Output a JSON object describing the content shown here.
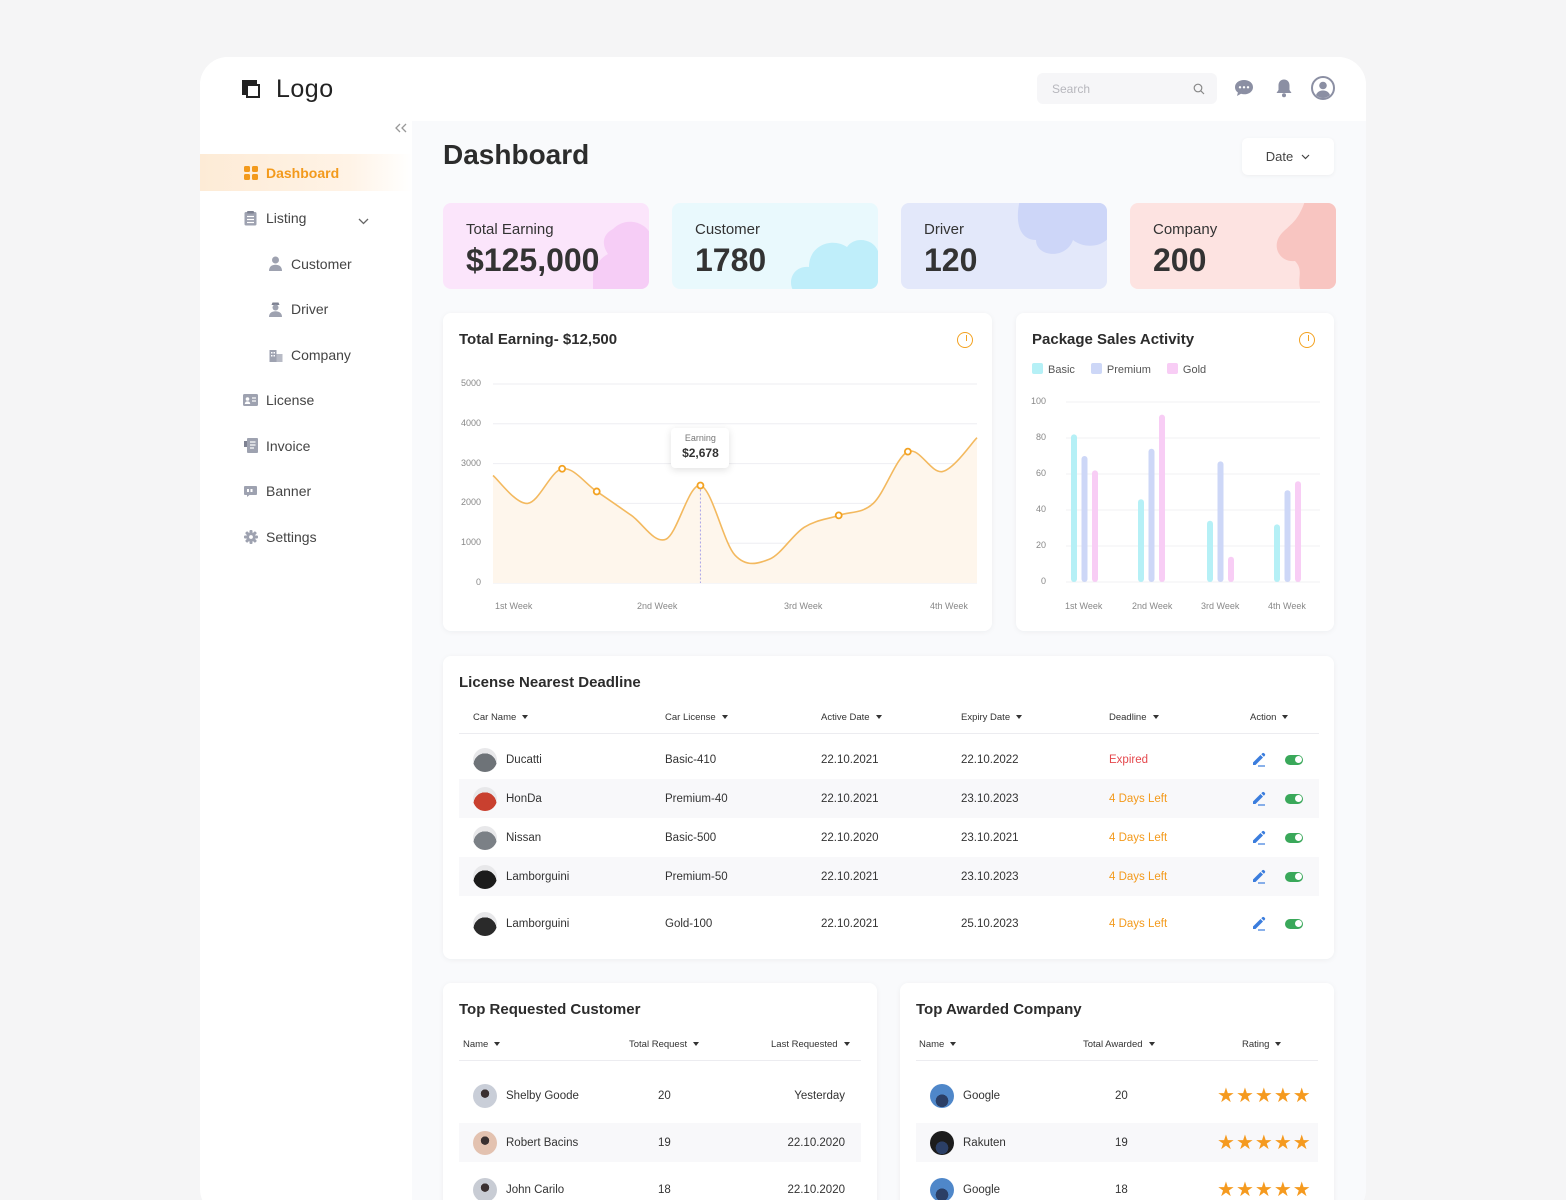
{
  "brand": {
    "logo_text": "Logo"
  },
  "search": {
    "placeholder": "Search"
  },
  "nav": {
    "items": [
      {
        "label": "Dashboard",
        "icon": "grid-icon",
        "active": true
      },
      {
        "label": "Listing",
        "icon": "list-icon"
      },
      {
        "label": "Customer",
        "icon": "user-icon",
        "sub": true
      },
      {
        "label": "Driver",
        "icon": "driver-icon",
        "sub": true
      },
      {
        "label": "Company",
        "icon": "building-icon",
        "sub": true
      },
      {
        "label": "License",
        "icon": "id-card-icon"
      },
      {
        "label": "Invoice",
        "icon": "invoice-icon"
      },
      {
        "label": "Banner",
        "icon": "banner-icon"
      },
      {
        "label": "Settings",
        "icon": "gear-icon"
      }
    ]
  },
  "page": {
    "title": "Dashboard",
    "date_label": "Date"
  },
  "stats": [
    {
      "label": "Total Earning",
      "value": "$125,000",
      "bg": "#fbe5fb",
      "blob": "#f6cdf6"
    },
    {
      "label": "Customer",
      "value": "1780",
      "bg": "#e9f9fd",
      "blob": "#bfeefa"
    },
    {
      "label": "Driver",
      "value": "120",
      "bg": "#e3e8fa",
      "blob": "#cdd6f8"
    },
    {
      "label": "Company",
      "value": "200",
      "bg": "#fde3e1",
      "blob": "#f8c5c1"
    }
  ],
  "earning_chart": {
    "title": "Total Earning- $12,500",
    "tooltip_label": "Earning",
    "tooltip_value": "$2,678",
    "chart_data": {
      "type": "area",
      "yticks": [
        "5000",
        "4000",
        "3000",
        "2000",
        "1000",
        "0"
      ],
      "ylim": [
        0,
        5000
      ],
      "xlabels": [
        "1st Week",
        "2nd Week",
        "3rd Week",
        "4th Week"
      ],
      "x": [
        0,
        0.5,
        1,
        1.5,
        2,
        2.5,
        3,
        3.5,
        4,
        4.5,
        5,
        5.5,
        6,
        6.5,
        7
      ],
      "y": [
        2700,
        2000,
        2870,
        2300,
        1700,
        1100,
        2450,
        700,
        600,
        1400,
        1700,
        2000,
        3300,
        2800,
        3650
      ],
      "markers": [
        2,
        3,
        6,
        10,
        12
      ],
      "highlight_index": 6,
      "color": "#f3b95f"
    }
  },
  "package_chart": {
    "title": "Package Sales Activity",
    "chart_data": {
      "type": "bar",
      "categories": [
        "1st Week",
        "2nd Week",
        "3rd Week",
        "4th Week"
      ],
      "yticks": [
        "100",
        "80",
        "60",
        "40",
        "20",
        "0"
      ],
      "ylim": [
        0,
        100
      ],
      "series": [
        {
          "name": "Basic",
          "color": "#b5f0f6",
          "values": [
            82,
            46,
            34,
            32
          ]
        },
        {
          "name": "Premium",
          "color": "#cdd7f7",
          "values": [
            70,
            74,
            67,
            51
          ]
        },
        {
          "name": "Gold",
          "color": "#f8cdf5",
          "values": [
            62,
            93,
            14,
            56
          ]
        }
      ]
    }
  },
  "license": {
    "title": "License Nearest Deadline",
    "headers": [
      "Car Name",
      "Car License",
      "Active Date",
      "Expiry Date",
      "Deadline",
      "Action"
    ],
    "rows": [
      {
        "car": "Ducatti",
        "license": "Basic-410",
        "active": "22.10.2021",
        "expiry": "22.10.2022",
        "deadline": "Expired",
        "status": "expired",
        "avatar": "#6e7378"
      },
      {
        "car": "HonDa",
        "license": "Premium-40",
        "active": "22.10.2021",
        "expiry": "23.10.2023",
        "deadline": "4 Days Left",
        "status": "left",
        "avatar": "#c9402f"
      },
      {
        "car": "Nissan",
        "license": "Basic-500",
        "active": "22.10.2020",
        "expiry": "23.10.2021",
        "deadline": "4 Days Left",
        "status": "left",
        "avatar": "#7b8086"
      },
      {
        "car": "Lamborguini",
        "license": "Premium-50",
        "active": "22.10.2021",
        "expiry": "23.10.2023",
        "deadline": "4 Days Left",
        "status": "left",
        "avatar": "#1b1b1b"
      },
      {
        "car": "Lamborguini",
        "license": "Gold-100",
        "active": "22.10.2021",
        "expiry": "25.10.2023",
        "deadline": "4 Days Left",
        "status": "left",
        "avatar": "#2a2a2a"
      }
    ]
  },
  "customers": {
    "title": "Top Requested Customer",
    "headers": [
      "Name",
      "Total Request",
      "Last Requested"
    ],
    "rows": [
      {
        "name": "Shelby Goode",
        "total": "20",
        "last": "Yesterday",
        "avatar": "#c9ced8"
      },
      {
        "name": "Robert Bacins",
        "total": "19",
        "last": "22.10.2020",
        "avatar": "#e3c2b0"
      },
      {
        "name": "John Carilo",
        "total": "18",
        "last": "22.10.2020",
        "avatar": "#c8ccd4"
      }
    ]
  },
  "companies": {
    "title": "Top Awarded Company",
    "headers": [
      "Name",
      "Total Awarded",
      "Rating"
    ],
    "rows": [
      {
        "name": "Google",
        "total": "20",
        "rating": 5,
        "avatar": "#4f87c9"
      },
      {
        "name": "Rakuten",
        "total": "19",
        "rating": 5,
        "avatar": "#1c1c1c"
      },
      {
        "name": "Google",
        "total": "18",
        "rating": 5,
        "avatar": "#4f87c9"
      }
    ]
  },
  "colors": {
    "accent": "#f39a1c",
    "expired": "#e5484d",
    "days_left": "#f39a1c",
    "edit": "#3b7ddd",
    "toggle": "#3aa85a"
  }
}
